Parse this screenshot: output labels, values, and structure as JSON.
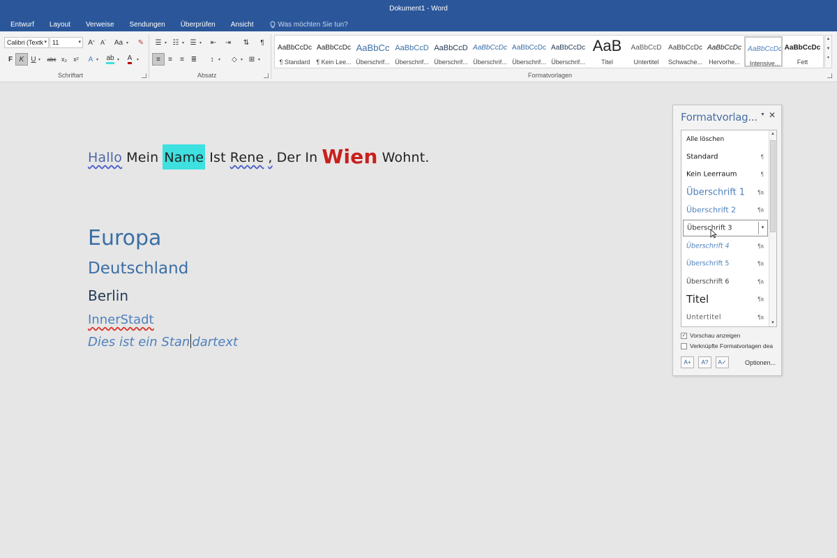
{
  "window": {
    "title": "Dokument1 - Word"
  },
  "tabs": [
    "Entwurf",
    "Layout",
    "Verweise",
    "Sendungen",
    "Überprüfen",
    "Ansicht"
  ],
  "tell_me": {
    "placeholder": "Was möchten Sie tun?",
    "icon": "lightbulb-icon"
  },
  "ribbon": {
    "font": {
      "name": "Calibri (Textk",
      "size": "11",
      "group_label": "Schriftart",
      "buttons": {
        "bold": "F",
        "italic": "K",
        "underline": "U",
        "strike": "abc",
        "subscript": "x₂",
        "superscript": "x²"
      }
    },
    "paragraph": {
      "group_label": "Absatz"
    },
    "styles": {
      "group_label": "Formatvorlagen",
      "items": [
        {
          "preview": "AaBbCcDc",
          "name": "¶ Standard"
        },
        {
          "preview": "AaBbCcDc",
          "name": "¶ Kein Lee..."
        },
        {
          "preview": "AaBbCc",
          "name": "Überschrif..."
        },
        {
          "preview": "AaBbCcD",
          "name": "Überschrif..."
        },
        {
          "preview": "AaBbCcD",
          "name": "Überschrif..."
        },
        {
          "preview": "AaBbCcDc",
          "name": "Überschrif..."
        },
        {
          "preview": "AaBbCcDc",
          "name": "Überschrif..."
        },
        {
          "preview": "AaBbCcDc",
          "name": "Überschrif..."
        },
        {
          "preview": "AaB",
          "name": "Titel"
        },
        {
          "preview": "AaBbCcD",
          "name": "Untertitel"
        },
        {
          "preview": "AaBbCcDc",
          "name": "Schwache..."
        },
        {
          "preview": "AaBbCcDc",
          "name": "Hervorhe..."
        },
        {
          "preview": "AaBbCcDc",
          "name": "Intensive..."
        },
        {
          "preview": "AaBbCcDc",
          "name": "Fett"
        }
      ]
    }
  },
  "document": {
    "sentence": {
      "w1": "Hallo",
      "w2": "Mein",
      "w3": "Name",
      "w4": "Ist",
      "w5": "Rene",
      "w6": ",",
      "w7": "Der",
      "w8": "In",
      "w9": "Wien",
      "w10": "Wohnt."
    },
    "h1": "Europa",
    "h2": "Deutschland",
    "h3": "Berlin",
    "h4": "InnerStadt",
    "h5_before_cursor": "Dies ist ein Stan",
    "h5_after_cursor": "dartext"
  },
  "styles_pane": {
    "title": "Formatvorlag...",
    "items": [
      {
        "label": "Alle löschen",
        "mark": ""
      },
      {
        "label": "Standard",
        "mark": "¶"
      },
      {
        "label": "Kein Leerraum",
        "mark": "¶"
      },
      {
        "label": "Überschrift 1",
        "mark": "¶a"
      },
      {
        "label": "Überschrift 2",
        "mark": "¶a"
      },
      {
        "label": "Überschrift 3",
        "mark": ""
      },
      {
        "label": "Überschrift 4",
        "mark": "¶a"
      },
      {
        "label": "Überschrift 5",
        "mark": "¶a"
      },
      {
        "label": "Überschrift 6",
        "mark": "¶a"
      },
      {
        "label": "Titel",
        "mark": "¶a"
      },
      {
        "label": "Untertitel",
        "mark": "¶a"
      }
    ],
    "show_preview": {
      "label": "Vorschau anzeigen",
      "checked": true
    },
    "linked_styles": {
      "label": "Verknüpfte Formatvorlagen dea",
      "checked": false
    },
    "options_label": "Optionen..."
  },
  "colors": {
    "title_bar": "#2b579a",
    "heading_blue": "#3b6ea5",
    "highlight": "#3fe0e0",
    "wien_red": "#c8201d"
  }
}
